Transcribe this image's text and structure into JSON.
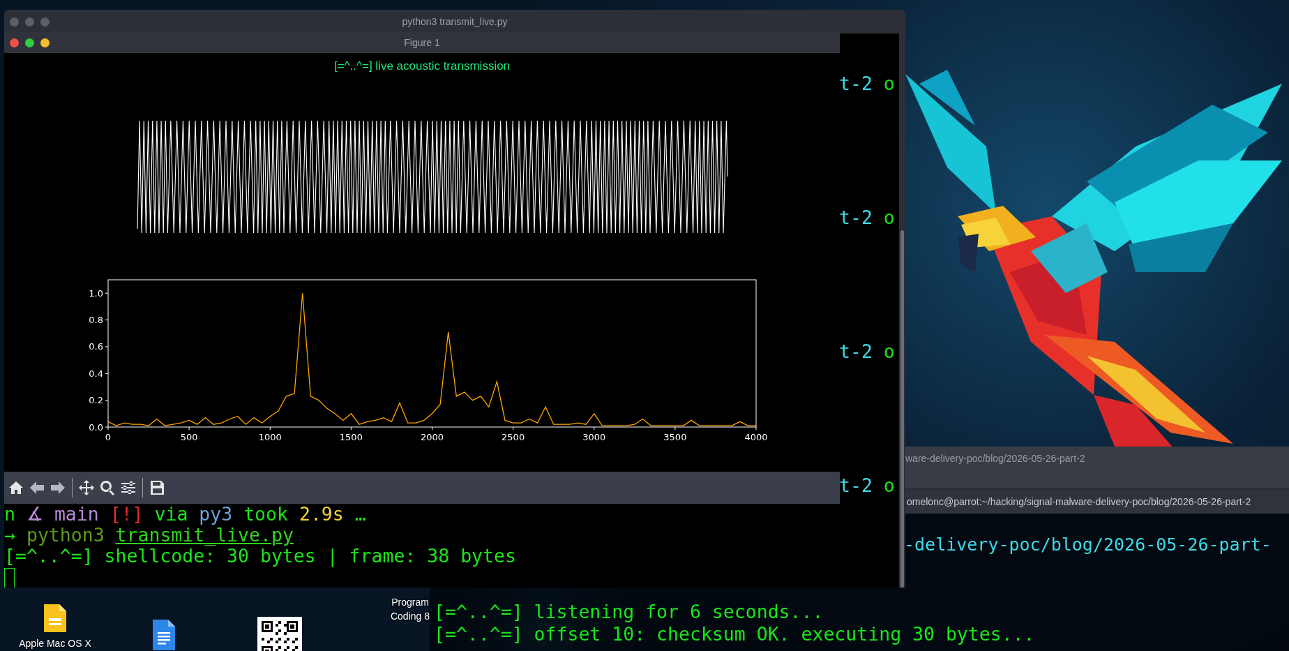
{
  "desktop": {
    "icons": [
      {
        "kind": "label-only",
        "lines": [
          "Program",
          "Coding 8"
        ]
      },
      {
        "kind": "slides",
        "lines": [
          "Apple Mac OS X"
        ]
      },
      {
        "kind": "doc"
      },
      {
        "kind": "qr"
      }
    ]
  },
  "background_window": {
    "title": "ware-delivery-poc/blog/2026-05-26-part-2"
  },
  "receiver_terminal": {
    "title": "omelonc@parrot:~/hacking/signal-malware-delivery-poc/blog/2026-05-26-part-2",
    "tail_line": [
      {
        "text": "-delivery-poc/blog/2026-05-26-part-",
        "kind": "cyan"
      }
    ],
    "lines": [
      [
        {
          "text": "[=^..^=] listening for 6 seconds...",
          "kind": "green"
        }
      ],
      [
        {
          "text": "[=^..^=] offset 10: checksum OK. executing 30 bytes...",
          "kind": "green"
        }
      ]
    ]
  },
  "terminal_window": {
    "title": "python3 transmit_live.py",
    "side_fragments": [
      [
        {
          "text": "t-2 ",
          "kind": "cyan"
        },
        {
          "text": "o",
          "kind": "green"
        }
      ],
      [
        {
          "text": "t-2 ",
          "kind": "cyan"
        },
        {
          "text": "o",
          "kind": "green"
        }
      ],
      [
        {
          "text": "t-2 ",
          "kind": "cyan"
        },
        {
          "text": "o",
          "kind": "green"
        }
      ],
      [
        {
          "text": "t-2 ",
          "kind": "cyan"
        },
        {
          "text": "o",
          "kind": "green"
        }
      ]
    ],
    "lines": [
      [
        {
          "text": "n ",
          "kind": "green"
        },
        {
          "text": "∡ main ",
          "kind": "purple"
        },
        {
          "text": "[!] ",
          "kind": "red"
        },
        {
          "text": "via ",
          "kind": "green"
        },
        {
          "text": "py3 ",
          "kind": "blue"
        },
        {
          "text": "took ",
          "kind": "green"
        },
        {
          "text": "2.9s ",
          "kind": "yellow"
        },
        {
          "text": "…",
          "kind": "green"
        }
      ],
      [
        {
          "text": "→ ",
          "kind": "green"
        },
        {
          "text": "python3 ",
          "kind": "olive"
        },
        {
          "text": "transmit_live.py",
          "kind": "path"
        }
      ],
      [
        {
          "text": "[=^..^=] shellcode: 30 bytes | frame: 38 bytes",
          "kind": "green"
        }
      ]
    ]
  },
  "figure_window": {
    "title": "Figure 1",
    "plot_title": "[=^..^=] live acoustic transmission",
    "spectrum": {
      "chart_data": {
        "type": "line",
        "x": [
          0,
          50,
          100,
          150,
          200,
          250,
          300,
          350,
          400,
          450,
          500,
          550,
          600,
          650,
          700,
          750,
          800,
          850,
          900,
          950,
          1000,
          1050,
          1100,
          1150,
          1200,
          1250,
          1300,
          1350,
          1400,
          1450,
          1500,
          1550,
          1600,
          1650,
          1700,
          1750,
          1800,
          1850,
          1900,
          1950,
          2000,
          2050,
          2100,
          2150,
          2200,
          2250,
          2300,
          2350,
          2400,
          2450,
          2500,
          2550,
          2600,
          2650,
          2700,
          2750,
          2800,
          2850,
          2900,
          2950,
          3000,
          3050,
          3100,
          3150,
          3200,
          3250,
          3300,
          3350,
          3400,
          3450,
          3500,
          3550,
          3600,
          3650,
          3700,
          3750,
          3800,
          3850,
          3900,
          3950,
          4000
        ],
        "values": [
          0.04,
          0.01,
          0.03,
          0.02,
          0.02,
          0.01,
          0.06,
          0.01,
          0.02,
          0.03,
          0.05,
          0.02,
          0.07,
          0.02,
          0.03,
          0.06,
          0.08,
          0.02,
          0.07,
          0.03,
          0.08,
          0.12,
          0.23,
          0.25,
          1.0,
          0.23,
          0.2,
          0.14,
          0.1,
          0.05,
          0.1,
          0.02,
          0.04,
          0.05,
          0.07,
          0.04,
          0.18,
          0.03,
          0.03,
          0.05,
          0.1,
          0.17,
          0.71,
          0.23,
          0.26,
          0.2,
          0.23,
          0.15,
          0.34,
          0.05,
          0.03,
          0.03,
          0.06,
          0.03,
          0.15,
          0.02,
          0.02,
          0.02,
          0.03,
          0.02,
          0.1,
          0.01,
          0.01,
          0.01,
          0.01,
          0.02,
          0.06,
          0.01,
          0.01,
          0.01,
          0.01,
          0.01,
          0.05,
          0.01,
          0.01,
          0.01,
          0.01,
          0.01,
          0.04,
          0.01,
          0.01
        ],
        "xlim": [
          0,
          4000
        ],
        "ylim": [
          0,
          1.1
        ],
        "xticks": [
          0,
          500,
          1000,
          1500,
          2000,
          2500,
          3000,
          3500,
          4000
        ],
        "yticks": [
          {
            "value": 0,
            "label": "0.0"
          },
          {
            "value": 0.2,
            "label": "0.2"
          },
          {
            "value": 0.4,
            "label": "0.4"
          },
          {
            "value": 0.6,
            "label": "0.6"
          },
          {
            "value": 0.8,
            "label": "0.8"
          },
          {
            "value": 1.0,
            "label": "1.0"
          }
        ]
      }
    },
    "toolbar": [
      {
        "kind": "home"
      },
      {
        "kind": "back"
      },
      {
        "kind": "forward"
      },
      {
        "kind": "separator"
      },
      {
        "kind": "pan"
      },
      {
        "kind": "zoom"
      },
      {
        "kind": "configure"
      },
      {
        "kind": "separator"
      },
      {
        "kind": "save"
      }
    ]
  }
}
